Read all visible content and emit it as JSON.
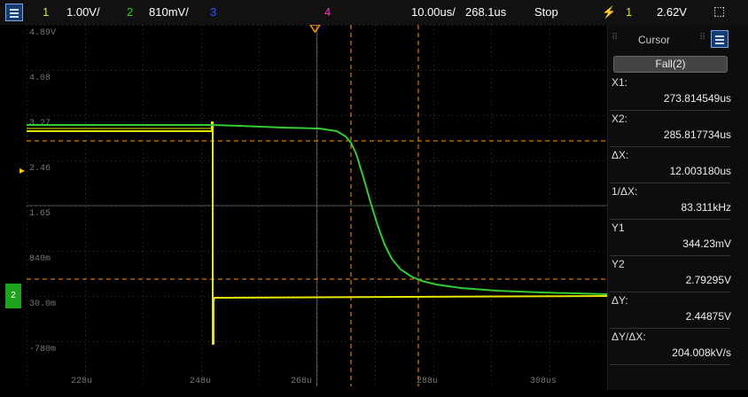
{
  "topbar": {
    "ch1_num": "1",
    "ch1_scale": "1.00V/",
    "ch2_num": "2",
    "ch2_scale": "810mV/",
    "ch3_num": "3",
    "ch4_num": "4",
    "timebase": "10.00us/",
    "delay": "268.1us",
    "run_state": "Stop",
    "trig_ch": "1",
    "trig_level": "2.62V"
  },
  "grid": {
    "y_labels": [
      "4.89V",
      "4.08",
      "3.27",
      "2.46",
      "1.65",
      "840m",
      "30.0m",
      "-780m"
    ],
    "x_labels": [
      "228u",
      "248u",
      "268u",
      "288u",
      "308us"
    ]
  },
  "marker": {
    "ch2_label": "2"
  },
  "panel": {
    "title": "Cursor",
    "mode": "Fall(2)",
    "rows": [
      {
        "label": "X1:",
        "value": "273.814549us"
      },
      {
        "label": "X2:",
        "value": "285.817734us"
      },
      {
        "label": "ΔX:",
        "value": "12.003180us"
      },
      {
        "label": "1/ΔX:",
        "value": "83.311kHz"
      },
      {
        "label": "Y1",
        "value": "344.23mV"
      },
      {
        "label": "Y2",
        "value": "2.79295V"
      },
      {
        "label": "ΔY:",
        "value": "2.44875V"
      },
      {
        "label": "ΔY/ΔX:",
        "value": "204.008kV/s"
      }
    ]
  },
  "colors": {
    "ch1": "#e6e600",
    "ch2": "#33cc33",
    "ch3": "#3355ff",
    "ch4": "#ff33cc",
    "cursor": "#ff9900"
  }
}
